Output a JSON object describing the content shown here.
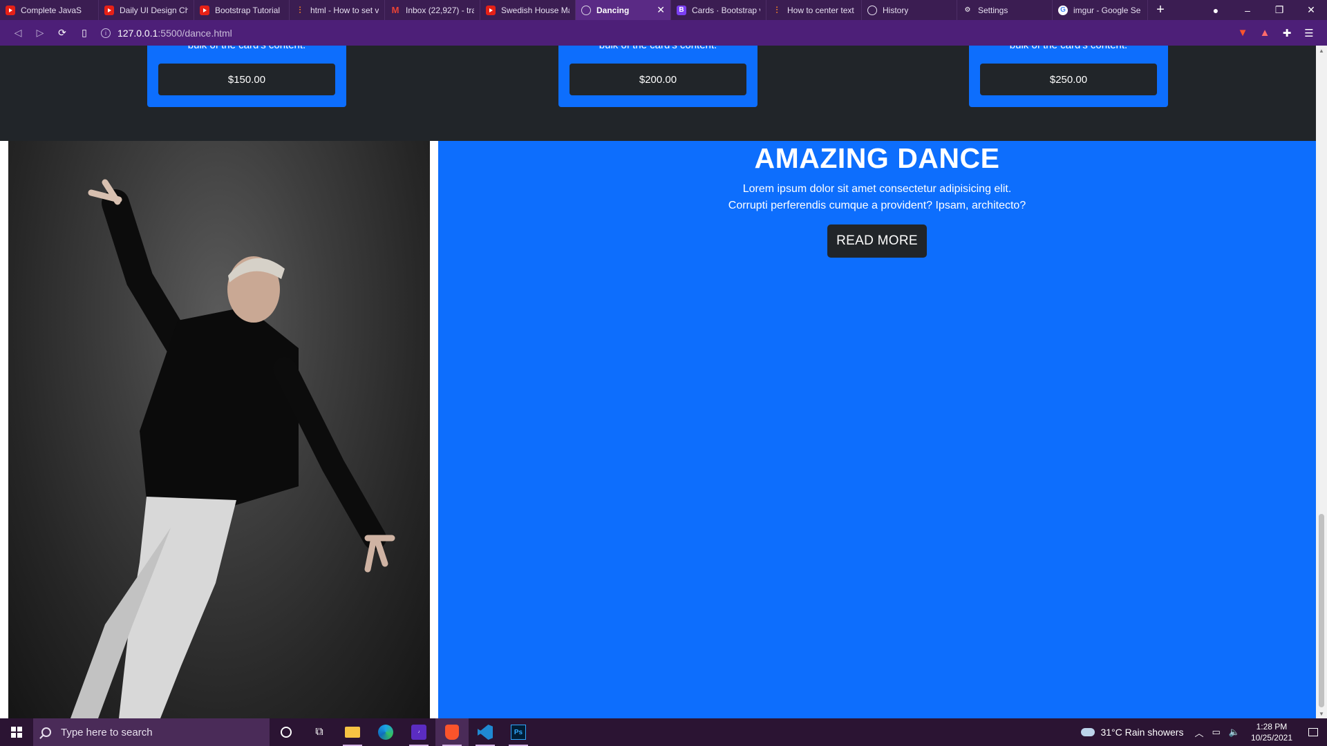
{
  "browser": {
    "tabs": [
      {
        "title": "Complete JavaS",
        "favicon": "youtube-icon",
        "width": 143
      },
      {
        "title": "Daily UI Design Ch",
        "favicon": "youtube-icon",
        "width": 138
      },
      {
        "title": "Bootstrap Tutorial",
        "favicon": "youtube-icon",
        "width": 138
      },
      {
        "title": "html - How to set v",
        "favicon": "stackoverflow-icon",
        "width": 138
      },
      {
        "title": "Inbox (22,927) - tra",
        "favicon": "gmail-icon",
        "width": 138
      },
      {
        "title": "Swedish House Ma",
        "favicon": "youtube-icon",
        "width": 138
      },
      {
        "title": "Dancing",
        "favicon": "globe-icon",
        "width": 138,
        "active": true
      },
      {
        "title": "Cards · Bootstrap v",
        "favicon": "bootstrap-icon",
        "width": 138
      },
      {
        "title": "How to center text",
        "favicon": "stackoverflow-icon",
        "width": 138
      },
      {
        "title": "History",
        "favicon": "history-icon",
        "width": 138
      },
      {
        "title": "Settings",
        "favicon": "settings-icon",
        "width": 138
      },
      {
        "title": "imgur - Google Se",
        "favicon": "google-icon",
        "width": 138
      }
    ],
    "url_host": "127.0.0.1",
    "url_path": ":5500/dance.html"
  },
  "cards": [
    {
      "cut_text": "bulk of the card's content.",
      "price": "$150.00"
    },
    {
      "cut_text": "bulk of the card's content.",
      "price": "$200.00"
    },
    {
      "cut_text": "bulk of the card's content.",
      "price": "$250.00"
    }
  ],
  "hero": {
    "title": "AMAZING DANCE",
    "lead_line1": "Lorem ipsum dolor sit amet consectetur adipisicing elit.",
    "lead_line2": "Corrupti perferendis cumque a provident? Ipsam, architecto?",
    "button": "READ MORE",
    "accent": "#0d6efd",
    "dark": "#212529"
  },
  "taskbar": {
    "search_placeholder": "Type here to search",
    "weather": "31°C  Rain showers",
    "time": "1:28 PM",
    "date": "10/25/2021"
  }
}
